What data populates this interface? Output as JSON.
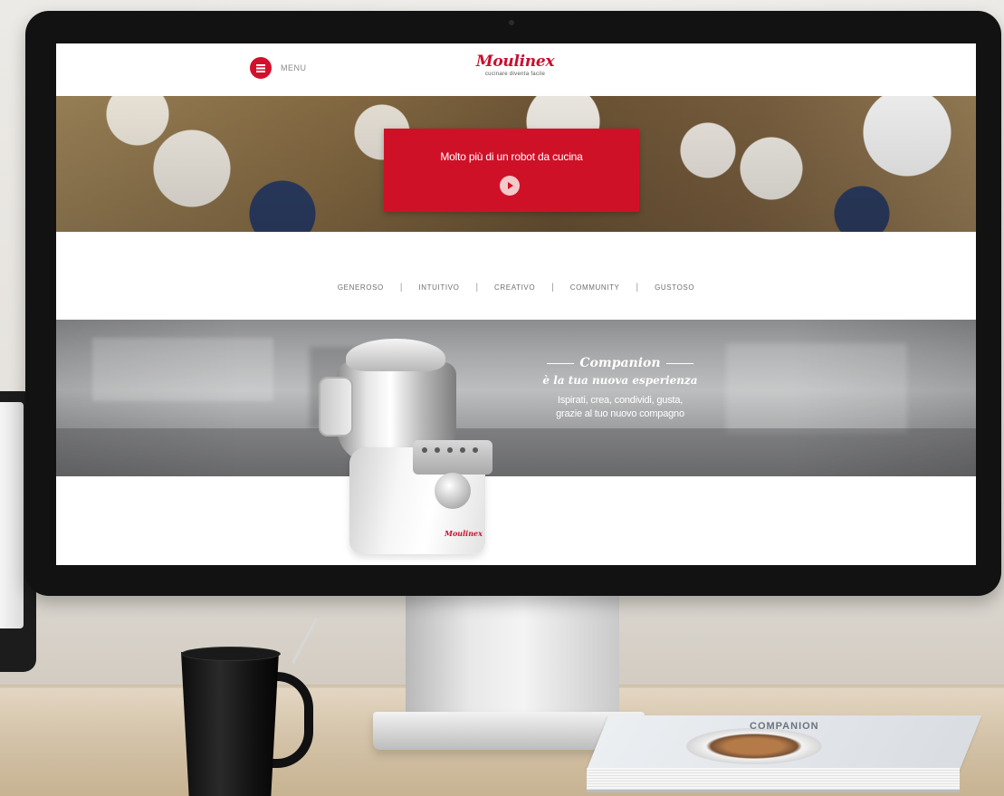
{
  "site": {
    "menu_label": "MENU",
    "logo_text": "Moulinex",
    "logo_tagline": "cucinare diventa facile",
    "hero_title": "Molto più di un robot da cucina",
    "nav": [
      "GENEROSO",
      "INTUITIVO",
      "CREATIVO",
      "COMMUNITY",
      "GUSTOSO"
    ],
    "promo": {
      "title": "Companion",
      "subtitle": "è la tua nuova esperienza",
      "body_line1": "Ispirati, crea, condividi, gusta,",
      "body_line2": "grazie al tuo nuovo compagno"
    },
    "appliance_logo": "Moulinex"
  },
  "scene": {
    "book_title": "COMPANION"
  },
  "colors": {
    "brand_red": "#cf1128",
    "logo_red": "#c8102e"
  }
}
